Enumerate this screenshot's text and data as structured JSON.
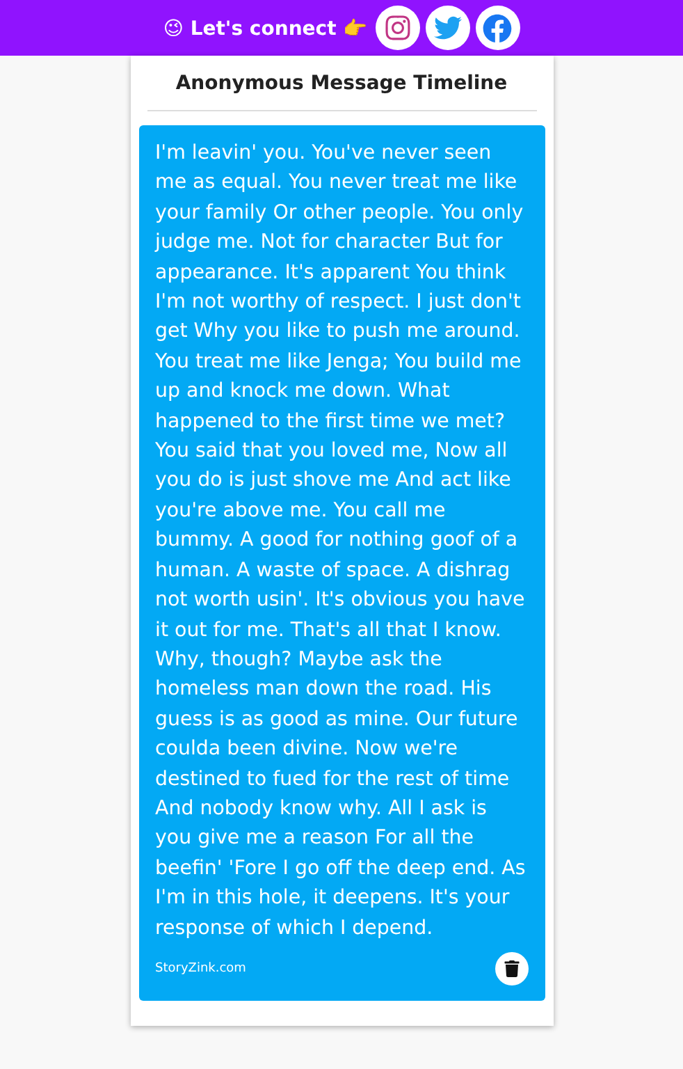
{
  "header": {
    "text": "😉 Let's connect 👉",
    "social_links": [
      {
        "kind": "instagram"
      },
      {
        "kind": "twitter"
      },
      {
        "kind": "facebook"
      }
    ]
  },
  "timeline": {
    "title": "Anonymous Message Timeline",
    "messages": [
      {
        "text": "I'm leavin' you. You've never seen me as equal. You never treat me like your family Or other people. You only judge me. Not for character But for appearance. It's apparent You think I'm not worthy of respect. I just don't get Why you like to push me around. You treat me like Jenga; You build me up and knock me down. What happened to the first time we met? You said that you loved me, Now all you do is just shove me And act like you're above me. You call me bummy. A good for nothing goof of a human. A waste of space. A dishrag not worth usin'. It's obvious you have it out for me. That's all that I know. Why, though? Maybe ask the homeless man down the road. His guess is as good as mine. Our future coulda been divine. Now we're destined to fued for the rest of time And nobody know why. All I ask is you give me a reason For all the beefin' 'Fore I go off the deep end. As I'm in this hole, it deepens. It's your response of which I depend.",
        "source": "StoryZink.com"
      }
    ]
  }
}
